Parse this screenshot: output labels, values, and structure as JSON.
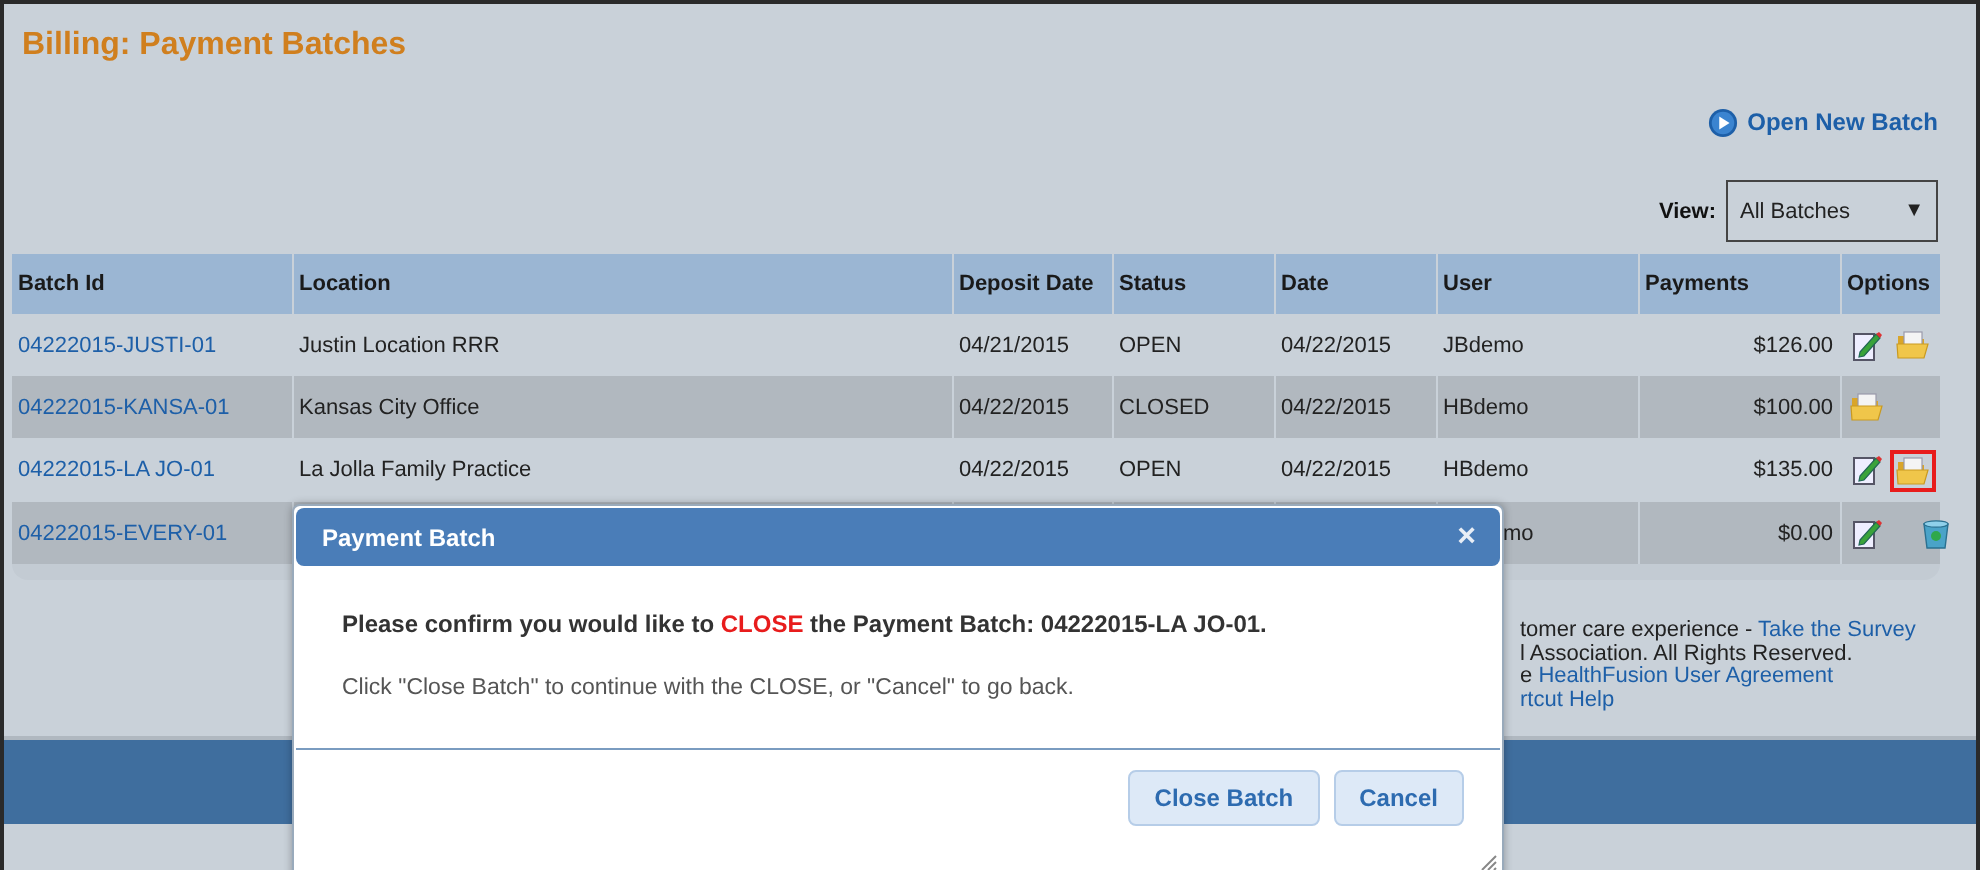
{
  "page_title": "Billing: Payment Batches",
  "open_new_batch": "Open New Batch",
  "view": {
    "label": "View:",
    "value": "All Batches",
    "caret": "▼"
  },
  "table": {
    "columns": [
      "Batch Id",
      "Location",
      "Deposit Date",
      "Status",
      "Date",
      "User",
      "Payments",
      "Options"
    ],
    "rows": [
      {
        "batch_id": "04222015-JUSTI-01",
        "location": "Justin Location RRR",
        "deposit_date": "04/21/2015",
        "status": "OPEN",
        "date": "04/22/2015",
        "user": "JBdemo",
        "payments": "$126.00",
        "options": [
          {
            "kind": "edit"
          },
          {
            "kind": "folder"
          }
        ]
      },
      {
        "batch_id": "04222015-KANSA-01",
        "location": "Kansas City Office",
        "deposit_date": "04/22/2015",
        "status": "CLOSED",
        "date": "04/22/2015",
        "user": "HBdemo",
        "payments": "$100.00",
        "options": [
          {
            "kind": "folder"
          }
        ]
      },
      {
        "batch_id": "04222015-LA JO-01",
        "location": "La Jolla Family Practice",
        "deposit_date": "04/22/2015",
        "status": "OPEN",
        "date": "04/22/2015",
        "user": "HBdemo",
        "payments": "$135.00",
        "options": [
          {
            "kind": "edit"
          },
          {
            "kind": "folder",
            "highlighted": true
          }
        ]
      },
      {
        "batch_id": "04222015-EVERY-01",
        "user": "mo",
        "payments": "$0.00",
        "options": [
          {
            "kind": "edit"
          },
          {
            "kind": "trash"
          }
        ]
      }
    ]
  },
  "footer": [
    {
      "text": "tomer care experience - ",
      "link": "Take the Survey"
    },
    {
      "text": "l Association. All Rights Reserved."
    },
    {
      "text": "e ",
      "link": "HealthFusion User Agreement"
    },
    {
      "link": "rtcut Help"
    }
  ],
  "dialog": {
    "title": "Payment Batch",
    "close": "×",
    "message": {
      "before": "Please confirm you would like to ",
      "highlight": "CLOSE",
      "after": " the Payment Batch: 04222015-LA JO-01."
    },
    "hint": "Click \"Close Batch\" to continue with the CLOSE, or \"Cancel\" to go back.",
    "buttons": [
      "Close Batch",
      "Cancel"
    ]
  }
}
